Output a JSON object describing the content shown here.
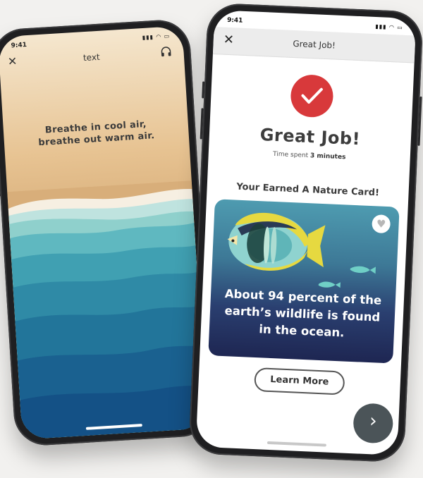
{
  "left_screen": {
    "status_time": "9:41",
    "status_icons": "▮▮▮ ◠ ▭",
    "title": "text",
    "close_icon": "✕",
    "icons": {
      "close": "close-icon",
      "headphones": "headphones-icon"
    },
    "breathe_line1": "Breathe in cool air,",
    "breathe_line2": "breathe out warm air."
  },
  "right_screen": {
    "status_time": "9:41",
    "status_icons": "▮▮▮ ◠ ▭",
    "header_title": "Great Job!",
    "close_icon": "✕",
    "icons": {
      "close": "close-icon",
      "check": "checkmark-icon",
      "heart": "heart-icon",
      "next": "chevron-right-icon"
    },
    "accent_color": "#d8393b",
    "headline": "Great Job!",
    "time_spent_label": "Time spent",
    "time_spent_value": "3 minutes",
    "earned_label": "Your Earned A Nature Card!",
    "card": {
      "fact_line1": "About 94 percent of the",
      "fact_line2": "earth’s wildlife is found",
      "fact_line3": "in the ocean."
    },
    "learn_more_label": "Learn More",
    "next_glyph": "›"
  }
}
